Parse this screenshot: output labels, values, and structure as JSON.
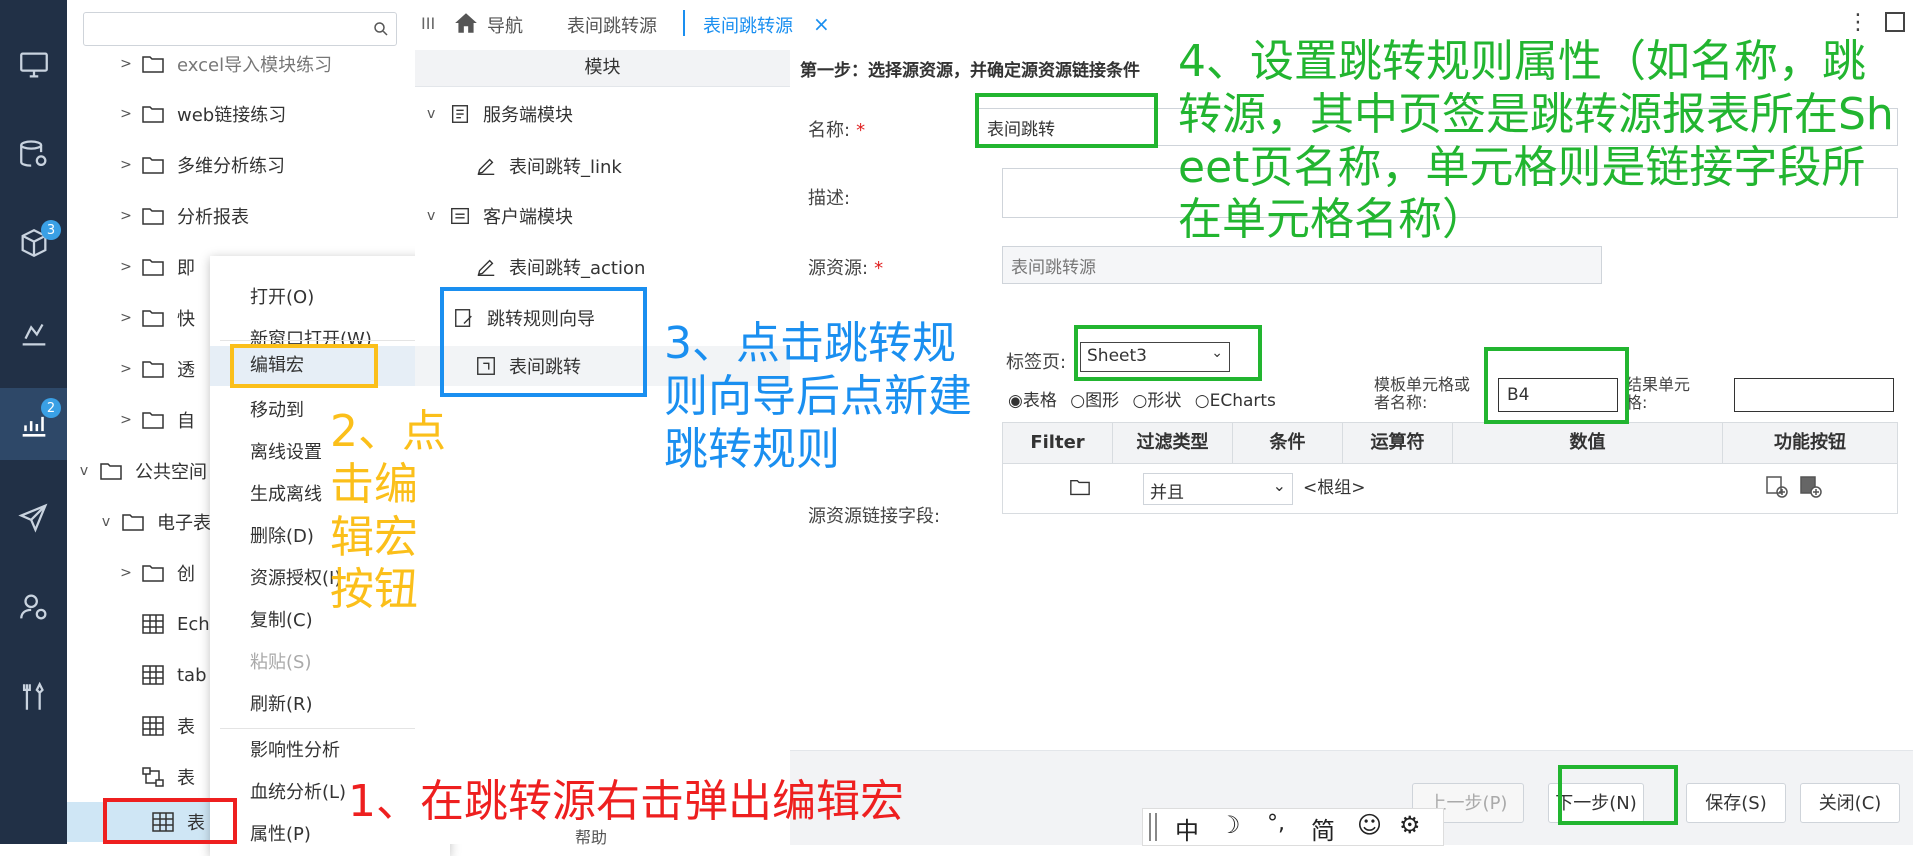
{
  "rail": {
    "badges": [
      "3",
      "2"
    ]
  },
  "tree": {
    "search_placeholder": "",
    "rows": [
      "excel导入模块练习",
      "web链接练习",
      "多维分析练习",
      "分析报表",
      "即",
      "快",
      "透",
      "自",
      "公共空间",
      "电子表",
      "创",
      "Ech",
      "tab",
      "表",
      "表",
      "表"
    ]
  },
  "context_menu": {
    "items": [
      "打开(O)",
      "新窗口打开(W)",
      "编辑宏",
      "移动到",
      "离线设置",
      "生成离线",
      "删除(D)",
      "资源授权(I)",
      "复制(C)",
      "粘贴(S)",
      "刷新(R)",
      "影响性分析",
      "血统分析(L)",
      "属性(P)"
    ]
  },
  "topbar": {
    "menu_glyph": "III",
    "home": "导航",
    "tab1": "表间跳转源",
    "tab2": "表间跳转源",
    "close": "×"
  },
  "modules": {
    "header": "模块",
    "server": "服务端模块",
    "server_child": "表间跳转_link",
    "client": "客户端模块",
    "client_child": "表间跳转_action",
    "wizard": "跳转规则向导",
    "wizard_child": "表间跳转",
    "help": "帮助"
  },
  "form": {
    "step_title": "第一步：选择源资源，并确定源资源链接条件",
    "name_label": "名称:",
    "name_value": "表间跳转",
    "desc_label": "描述:",
    "source_label": "源资源:",
    "source_value": "表间跳转源",
    "sheet_label": "标签页:",
    "sheet_value": "Sheet3",
    "radio": [
      "表格",
      "图形",
      "形状",
      "ECharts"
    ],
    "template_cell_label": "模板单元格或者名称:",
    "template_cell_value": "B4",
    "result_cell_label": "结果单元格:",
    "link_field_label": "源资源链接字段:",
    "grid_headers": [
      "Filter",
      "过滤类型",
      "条件",
      "运算符",
      "数值",
      "功能按钮"
    ],
    "filter_type": "并且",
    "root_group": "<根组>"
  },
  "buttons": {
    "prev": "上一步(P)",
    "next": "下一步(N)",
    "save": "保存(S)",
    "close": "关闭(C)"
  },
  "annotations": {
    "a1": "1、在跳转源右击弹出编辑宏",
    "a2": "2、点击编辑宏按钮",
    "a3": "3、点击跳转规则向导后点新建跳转规则",
    "a4": "4、设置跳转规则属性（如名称，跳转源，其中页签是跳转源报表所在Sheet页名称，单元格则是链接字段所在单元格名称）"
  },
  "ime": [
    "中",
    "☽",
    "°,",
    "简",
    "☺",
    "⚙"
  ],
  "colors": {
    "rail": "#213046",
    "green": "#22b530",
    "orange": "#fbbf1a",
    "blue": "#1a8ff0",
    "red": "#ee1f1f"
  }
}
